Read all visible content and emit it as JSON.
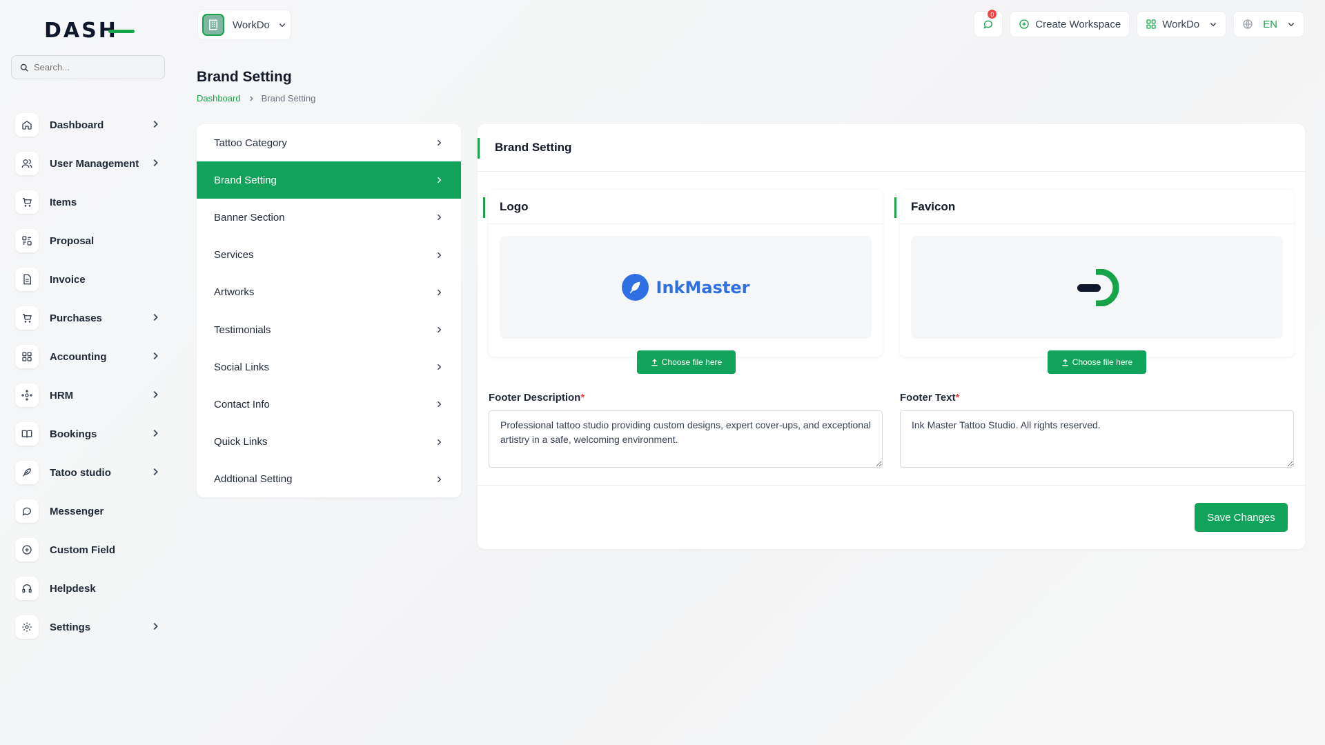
{
  "brand": {
    "logo_text": "DASH"
  },
  "search": {
    "placeholder": "Search..."
  },
  "sidebar": {
    "items": [
      {
        "label": "Dashboard",
        "icon": "home-icon",
        "has_children": true
      },
      {
        "label": "User Management",
        "icon": "users-icon",
        "has_children": true
      },
      {
        "label": "Items",
        "icon": "cart-icon",
        "has_children": false
      },
      {
        "label": "Proposal",
        "icon": "proposal-icon",
        "has_children": false
      },
      {
        "label": "Invoice",
        "icon": "invoice-icon",
        "has_children": false
      },
      {
        "label": "Purchases",
        "icon": "cart-icon",
        "has_children": true
      },
      {
        "label": "Accounting",
        "icon": "grid-icon",
        "has_children": true
      },
      {
        "label": "HRM",
        "icon": "hrm-icon",
        "has_children": true
      },
      {
        "label": "Bookings",
        "icon": "book-icon",
        "has_children": true
      },
      {
        "label": "Tatoo studio",
        "icon": "feather-icon",
        "has_children": true
      },
      {
        "label": "Messenger",
        "icon": "chat-icon",
        "has_children": false
      },
      {
        "label": "Custom Field",
        "icon": "plus-circle-icon",
        "has_children": false
      },
      {
        "label": "Helpdesk",
        "icon": "headphones-icon",
        "has_children": false
      },
      {
        "label": "Settings",
        "icon": "gear-icon",
        "has_children": true
      }
    ]
  },
  "header": {
    "workspace_name": "WorkDo",
    "message_count": "0",
    "create_workspace": "Create Workspace",
    "workspace_menu": "WorkDo",
    "language": "EN"
  },
  "page": {
    "title": "Brand Setting",
    "breadcrumb": {
      "home": "Dashboard",
      "current": "Brand Setting"
    }
  },
  "settings_menu": {
    "active_index": 1,
    "items": [
      "Tattoo Category",
      "Brand Setting",
      "Banner Section",
      "Services",
      "Artworks",
      "Testimonials",
      "Social Links",
      "Contact Info",
      "Quick Links",
      "Addtional Setting"
    ]
  },
  "brand_setting": {
    "card_title": "Brand Setting",
    "logo": {
      "title": "Logo",
      "preview_text": "InkMaster",
      "choose_label": "Choose file here"
    },
    "favicon": {
      "title": "Favicon",
      "choose_label": "Choose file here"
    },
    "footer_description": {
      "label": "Footer Description",
      "required_mark": "*",
      "value": "Professional tattoo studio providing custom designs, expert cover-ups, and exceptional artistry in a safe, welcoming environment."
    },
    "footer_text": {
      "label": "Footer Text",
      "required_mark": "*",
      "value": "Ink Master Tattoo Studio. All rights reserved."
    },
    "save_label": "Save Changes"
  },
  "colors": {
    "accent": "#12a35a",
    "brand_blue": "#2f6fe4",
    "danger": "#ef4444"
  }
}
